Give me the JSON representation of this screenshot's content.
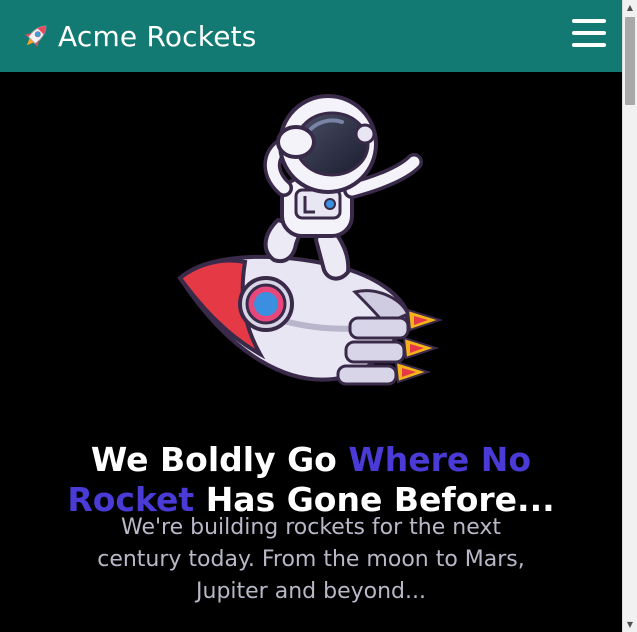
{
  "header": {
    "brand_name": "Acme Rockets",
    "brand_icon": "rocket-icon",
    "menu_icon": "hamburger-menu-icon",
    "background_color": "#137a73"
  },
  "hero": {
    "image_icon": "astronaut-on-rocket-illustration",
    "headline_part1": "We Boldly Go ",
    "headline_accent1": "Where No",
    "headline_accent2": "Rocket",
    "headline_part2": " Has Gone Before...",
    "accent_color": "#4a3ad6",
    "subtext": "We're building rockets for the next century today. From the moon to Mars, Jupiter and beyond..."
  }
}
